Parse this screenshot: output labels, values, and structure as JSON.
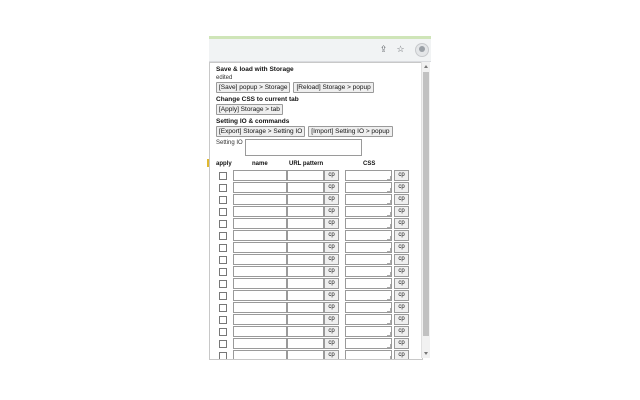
{
  "popup": {
    "section_storage": "Save & load with Storage",
    "status": "edited",
    "btn_save": "[Save] popup > Storage",
    "btn_reload": "[Reload] Storage > popup",
    "section_css": "Change CSS to current tab",
    "btn_apply": "[Apply] Storage > tab",
    "section_io": "Setting IO & commands",
    "btn_export": "[Export] Storage > Setting IO",
    "btn_import": "[Import] Setting IO > popup",
    "io_label": "Setting IO",
    "col_apply": "apply",
    "col_name": "name",
    "col_url": "URL pattern",
    "col_css": "CSS",
    "cp_label": "cp",
    "row_count": 17
  },
  "colors": {
    "top_strip": "#cfe5b8",
    "toolbar": "#f1f3f4"
  },
  "icons": [
    "share-icon",
    "star-icon",
    "profile-avatar-icon"
  ]
}
